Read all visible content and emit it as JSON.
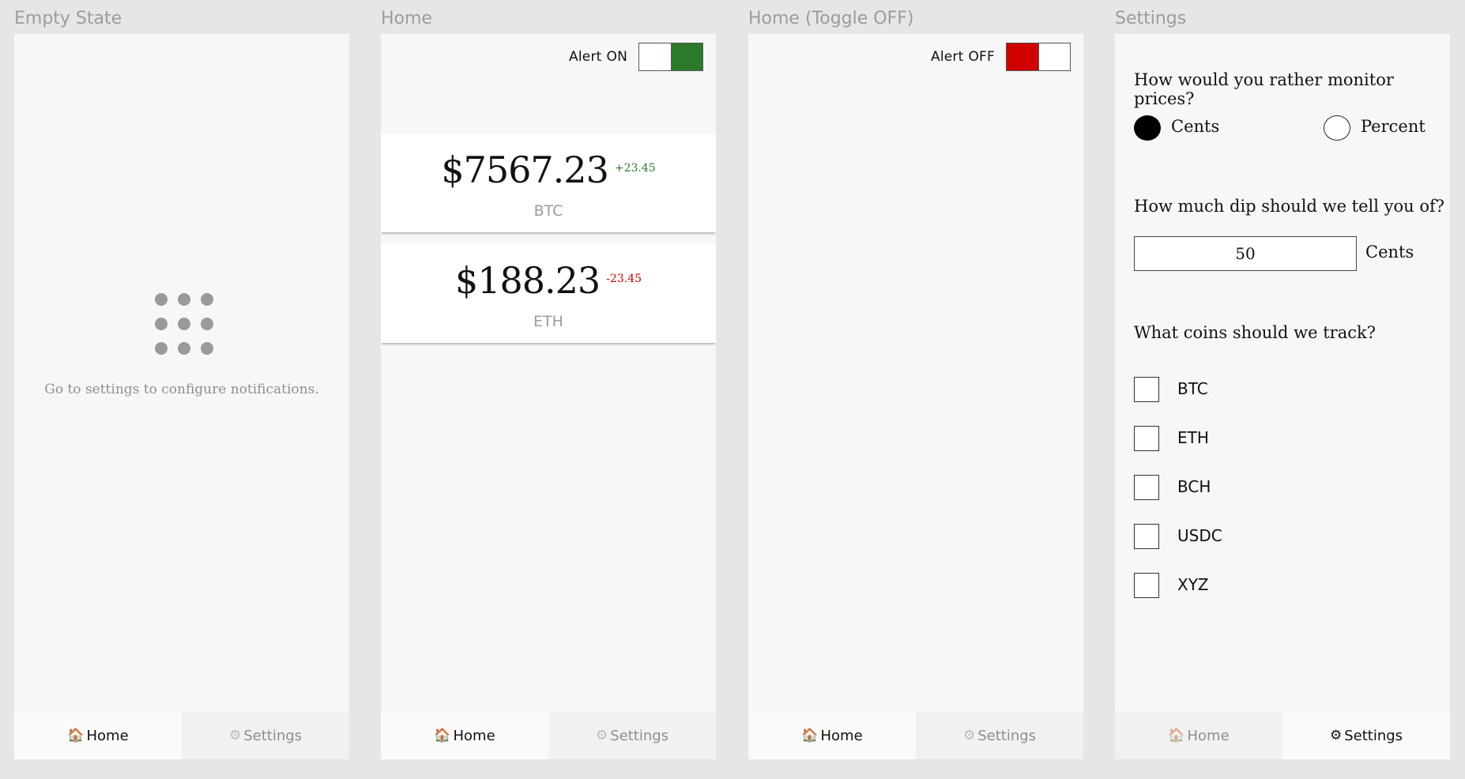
{
  "tabs": {
    "home_label": "Home",
    "settings_label": "Settings",
    "home_icon": "🏠",
    "settings_icon": "⚙"
  },
  "screens": {
    "empty": {
      "title": "Empty State",
      "message": "Go to settings to configure notifications."
    },
    "home": {
      "title": "Home",
      "alert_label": "Alert",
      "alert_state": "ON",
      "coins": [
        {
          "price": "$7567.23",
          "change": "+23.45",
          "symbol": "BTC",
          "change_color": "#2a7a2a"
        },
        {
          "price": "$188.23",
          "change": "-23.45",
          "symbol": "ETH",
          "change_color": "#d10000"
        }
      ]
    },
    "home_off": {
      "title": "Home (Toggle OFF)",
      "alert_label": "Alert",
      "alert_state": "OFF"
    },
    "settings": {
      "title": "Settings",
      "q_monitor": "How would you rather monitor prices?",
      "opt_cents": "Cents",
      "opt_percent": "Percent",
      "q_dip": "How much dip should we tell you of?",
      "dip_value": "50",
      "dip_unit": "Cents",
      "q_coins": "What coins should we track?",
      "coins": [
        "BTC",
        "ETH",
        "BCH",
        "USDC",
        "XYZ"
      ]
    }
  },
  "colors": {
    "toggle_on": "#2a7a2a",
    "toggle_off": "#d10000"
  }
}
